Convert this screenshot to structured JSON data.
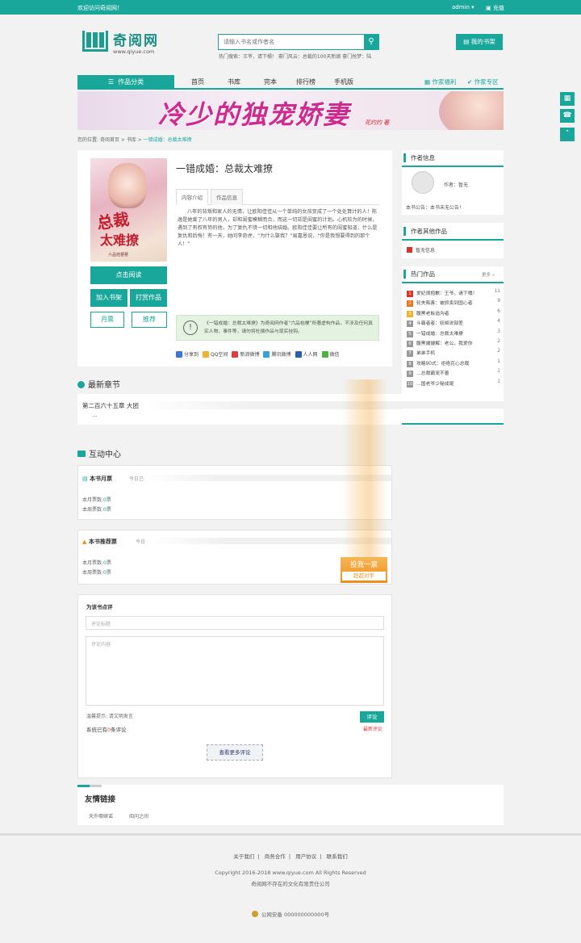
{
  "topbar": {
    "welcome": "欢迎访问奇阅网！",
    "user": "admin ▾",
    "charge": "充值"
  },
  "header": {
    "logo_cn": "奇阅网",
    "logo_url": "www.qiyue.com",
    "search_placeholder": "请输入书名或作者名",
    "search_icon": "search-icon",
    "hotwords": "热门搜索：王爷，请下榻！ 豪门风云：总裁的100天新娘 豪门抢梦：陆",
    "mybook": "我的书架"
  },
  "nav": {
    "category": "作品分类",
    "items": [
      "首页",
      "书库",
      "完本",
      "排行榜",
      "手机版"
    ],
    "author_fund": "作家福利",
    "author_zone": "作家专区"
  },
  "banner": {
    "title": "冷少的独宠娇妻",
    "author": "花灼灼 著"
  },
  "breadcrumb": {
    "prefix": "您的位置:",
    "home": "奇阅首页",
    "lib": "书库",
    "current": "一错成婚：总裁太难撩"
  },
  "book": {
    "title": "一错成婚：总裁太难撩",
    "cover_title1": "总裁",
    "cover_title2": "太难撩",
    "cover_author": "六品桔梗著",
    "tabs": [
      "内容介绍",
      "作品信息"
    ],
    "intro": "八年的背叛和家人的无情，让欧阳佳佳从一个单纯的女孩变成了一个处处算计的人！陈逸是她爱了八年的男人，却和闺蜜模糊而合，而这一切却是闺蜜的计划。心机较为的时候，遇到了有权有势的他，为了复仇不惜一切和他结婚。欧阳佳佳要让所有的闺蜜知道，什么是复仇和后悔！有一天，她问李奇虎，“为什么娶我？”易嘉恩说，“你是我想要得到的那个人！”",
    "read_btn": "点击阅读",
    "add_shelf": "加入书架",
    "reward": "打赏作品",
    "monthly": "月票",
    "recommend": "推荐",
    "notice": "《一错成婚：总裁太难撩》为奇阅网作者“六品桔梗”所著虚构作品，不涉及任何真实人物、事件等，请勿将杜撰作品与现实挂钩。",
    "share": [
      "分享到",
      "QQ空间",
      "新浪微博",
      "腾讯微博",
      "人人网",
      "微信"
    ]
  },
  "latest": {
    "title": "最新章节",
    "chapter": "第二百六十五章 大团",
    "ellipsis": "..."
  },
  "interact": {
    "title": "互动中心",
    "monthly_title": "本书月票",
    "today": "今日已",
    "month_count_label": "本月票数:",
    "month_count": "0",
    "week_count_label": "本周票数:",
    "week_count": "0",
    "rec_title": "本书推荐票",
    "today2": "今日",
    "rec_month_label": "本月票数:",
    "rec_month": "0",
    "rec_week_label": "本周票数:",
    "rec_week": "0",
    "vote_btn": "投我一票",
    "vote_sub": "赶超对手"
  },
  "comment": {
    "title": "为该书点评",
    "title_placeholder": "评论标题",
    "content_placeholder": "评论内容",
    "hint": "温馨提示: 请文明发言",
    "submit": "评论",
    "count_prefix": "系统已有",
    "count": "0",
    "count_suffix": "条评论",
    "latest": "最新评论",
    "more": "查看更多评论"
  },
  "sidebar": {
    "author_info": "作者信息",
    "author_label": "作者：",
    "author_name": "暂无",
    "notice_label": "本书公告：",
    "notice": "本书未无公告！",
    "author_other": "作者其他作品",
    "no_info": "暂无信息",
    "hot": "热门作品",
    "hot_more": "更多 »",
    "hot_list": [
      {
        "n": "1",
        "name": "爱妃很抱歉：王爷，请下榻！",
        "cnt": "11",
        "color": "#d9342b"
      },
      {
        "n": "2",
        "name": "轮夫陷害：被抓卖到国心者",
        "cnt": "9",
        "color": "#e87722"
      },
      {
        "n": "3",
        "name": "腹黑老板追沟者",
        "cnt": "6",
        "color": "#f0b22c"
      },
      {
        "n": "4",
        "name": "斗霸者者：妖姬说部差",
        "cnt": "4",
        "color": "#999999"
      },
      {
        "n": "5",
        "name": "一错成婚：总裁太难撩",
        "cnt": "3",
        "color": "#999999"
      },
      {
        "n": "6",
        "name": "腹黑嫂嫂解：老公，我爱你",
        "cnt": "2",
        "color": "#999999"
      },
      {
        "n": "7",
        "name": "弟弟手机",
        "cnt": "2",
        "color": "#999999"
      },
      {
        "n": "8",
        "name": "攻略90式：拒绝花心总裁",
        "cnt": "1",
        "color": "#999999"
      },
      {
        "n": "9",
        "name": "…总裁霸宠不善",
        "cnt": "1",
        "color": "#999999"
      },
      {
        "n": "10",
        "name": "…国老爷少秘成尾",
        "cnt": "1",
        "color": "#999999"
      }
    ]
  },
  "friend_links": {
    "title": "友情链接",
    "links": [
      "天外哪嫔谣",
      "阅问之间"
    ]
  },
  "footer": {
    "links": [
      "关于我们",
      "商务合作",
      "用户协议",
      "联系我们"
    ],
    "copyright": "Copyright 2016-2018 www.qiyue.com All Rights Reserved",
    "company": "奇阅网不存在的文化有限责任公司",
    "icp": "公网安备 000000000000号"
  },
  "colors": {
    "accent": "#19a79b",
    "orange": "#ee8d18"
  }
}
